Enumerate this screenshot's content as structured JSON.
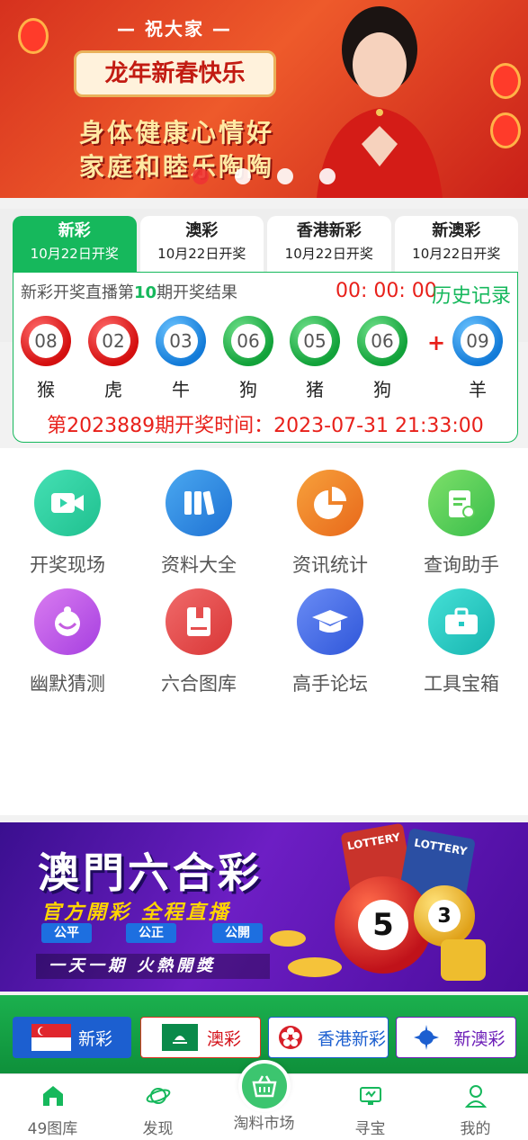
{
  "banner": {
    "wish": "— 祝大家 —",
    "plaque": "龙年新春快乐",
    "line1": "身体健康心情好",
    "line2": "家庭和睦乐陶陶",
    "dots_count": 4,
    "active_dot": 0
  },
  "lottery": {
    "tabs": [
      {
        "title": "新彩",
        "date": "10月22日开奖",
        "active": true
      },
      {
        "title": "澳彩",
        "date": "10月22日开奖",
        "active": false
      },
      {
        "title": "香港新彩",
        "date": "10月22日开奖",
        "active": false
      },
      {
        "title": "新澳彩",
        "date": "10月22日开奖",
        "active": false
      }
    ],
    "head_prefix": "新彩开奖直播第",
    "head_issue": "10",
    "head_suffix": "期开奖结果",
    "timer": "00: 00: 00",
    "history_link": "历史记录",
    "balls": [
      {
        "num": "08",
        "color": "red",
        "zodiac": "猴"
      },
      {
        "num": "02",
        "color": "red",
        "zodiac": "虎"
      },
      {
        "num": "03",
        "color": "blue",
        "zodiac": "牛"
      },
      {
        "num": "06",
        "color": "green",
        "zodiac": "狗"
      },
      {
        "num": "05",
        "color": "green",
        "zodiac": "猪"
      },
      {
        "num": "06",
        "color": "green",
        "zodiac": "狗"
      }
    ],
    "plus": "+",
    "special": {
      "num": "09",
      "color": "blue",
      "zodiac": "羊"
    },
    "next_time": "第2023889期开奖时间：2023-07-31 21:33:00"
  },
  "menu": [
    {
      "label": "开奖现场",
      "icon": "video-icon",
      "color": "#2fd3a8"
    },
    {
      "label": "资料大全",
      "icon": "books-icon",
      "color": "#2f8fe0"
    },
    {
      "label": "资讯统计",
      "icon": "pie-chart-icon",
      "color": "#f08a24"
    },
    {
      "label": "查询助手",
      "icon": "search-doc-icon",
      "color": "#5ccf5a"
    },
    {
      "label": "幽默猜测",
      "icon": "joker-icon",
      "color": "#c45ce0"
    },
    {
      "label": "六合图库",
      "icon": "album-icon",
      "color": "#e54e4e"
    },
    {
      "label": "高手论坛",
      "icon": "graduation-cap-icon",
      "color": "#3f6fe0"
    },
    {
      "label": "工具宝箱",
      "icon": "toolbox-icon",
      "color": "#25c9c4"
    }
  ],
  "promo": {
    "title": "澳門六合彩",
    "subtitle": "官方開彩  全程直播",
    "pills": [
      "公平",
      "公正",
      "公開"
    ],
    "slogan": "一天一期  火熱開獎",
    "ball_numbers": [
      "5",
      "3"
    ],
    "card_labels": [
      "LOTTERY",
      "LOTTERY"
    ]
  },
  "strip": {
    "chips": [
      {
        "label": "新彩",
        "selected": true,
        "flag": "singapore-flag-icon"
      },
      {
        "label": "澳彩",
        "selected": false,
        "flag": "macau-flag-icon"
      },
      {
        "label": "香港新彩",
        "selected": false,
        "flag": "hongkong-flag-icon"
      },
      {
        "label": "新澳彩",
        "selected": false,
        "flag": "star-flag-icon"
      }
    ]
  },
  "tabbar": {
    "items": [
      {
        "label": "49图库",
        "icon": "home-icon"
      },
      {
        "label": "发现",
        "icon": "planet-icon"
      },
      {
        "label": "淘料市场",
        "icon": "basket-icon"
      },
      {
        "label": "寻宝",
        "icon": "monitor-icon"
      },
      {
        "label": "我的",
        "icon": "user-icon"
      }
    ]
  },
  "colors": {
    "brand_green": "#16b85c",
    "accent_red": "#e8201a"
  }
}
